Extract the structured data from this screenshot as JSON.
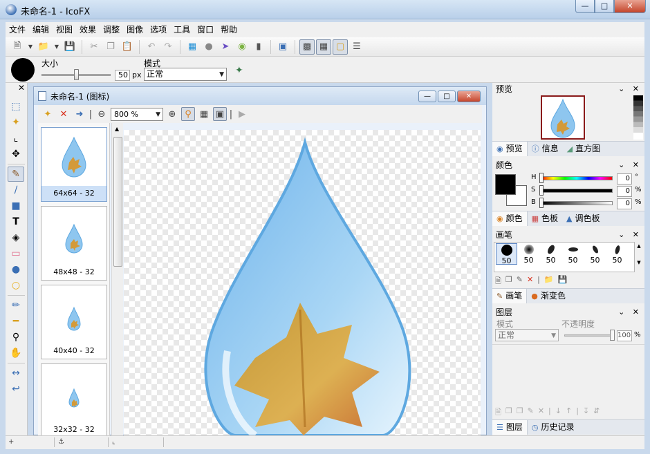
{
  "window": {
    "title": "未命名-1 - IcoFX"
  },
  "menu": [
    "文件",
    "编辑",
    "视图",
    "效果",
    "调整",
    "图像",
    "选项",
    "工具",
    "窗口",
    "帮助"
  ],
  "options": {
    "size_label": "大小",
    "size_value": "50",
    "size_unit": "px",
    "mode_label": "模式",
    "mode_value": "正常"
  },
  "document": {
    "title": "未命名-1 (图标)",
    "zoom": "800 %",
    "thumbnails": [
      {
        "label": "64x64 - 32"
      },
      {
        "label": "48x48 - 32"
      },
      {
        "label": "40x40 - 32"
      },
      {
        "label": "32x32 - 32"
      }
    ]
  },
  "panels": {
    "preview": {
      "title": "预览",
      "tabs": [
        "预览",
        "信息",
        "直方图"
      ]
    },
    "color": {
      "title": "颜色",
      "h_label": "H",
      "s_label": "S",
      "b_label": "B",
      "h_value": "0",
      "s_value": "0",
      "b_value": "0",
      "h_unit": "°",
      "s_unit": "%",
      "b_unit": "%",
      "tabs": [
        "颜色",
        "色板",
        "调色板"
      ]
    },
    "brush": {
      "title": "画笔",
      "sizes": [
        "50",
        "50",
        "50",
        "50",
        "50",
        "50"
      ],
      "tabs": [
        "画笔",
        "渐变色"
      ]
    },
    "layers": {
      "title": "图层",
      "mode_label": "模式",
      "mode_value": "正常",
      "opacity_label": "不透明度",
      "opacity_value": "100",
      "opacity_unit": "%",
      "tabs": [
        "图层",
        "历史记录"
      ]
    }
  },
  "colors": {
    "accent": "#3b6fb4",
    "close": "#c4442a"
  }
}
